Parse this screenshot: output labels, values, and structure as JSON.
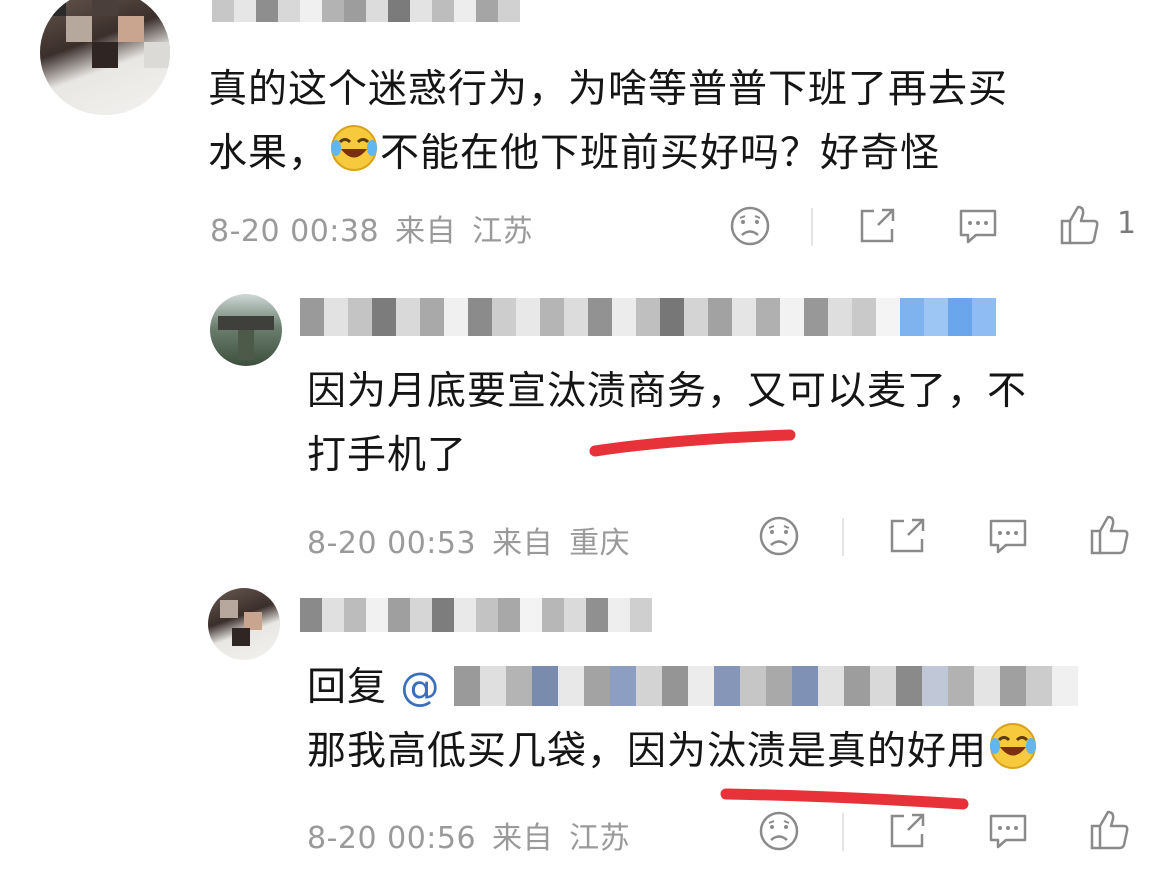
{
  "comments": [
    {
      "text_line1": "真的这个迷惑行为，为啥等普普下班了再去买",
      "text_line2_a": "水果，",
      "text_line2_b": "不能在他下班前买好吗？好奇怪",
      "time": "8-20 00:38",
      "from_label": "来自",
      "location": "江苏",
      "like_count": "1"
    },
    {
      "text_line1": "因为月底要宣汰渍商务，又可以麦了，不",
      "text_line2": "打手机了",
      "time": "8-20 00:53",
      "from_label": "来自",
      "location": "重庆"
    },
    {
      "reply_prefix": "回复",
      "mention": "@",
      "text_line2": "那我高低买几袋，因为汰渍是真的好用",
      "time": "8-20 00:56",
      "from_label": "来自",
      "location": "江苏"
    }
  ],
  "colors": {
    "annotation_red": "#e8323a",
    "meta_gray": "#9a9a9a",
    "icon_gray": "#8a8a8a",
    "mention_blue": "#3a6fbb"
  },
  "icons": [
    "sad-face-icon",
    "share-icon",
    "comment-icon",
    "like-icon",
    "laughing-crying-emoji"
  ]
}
